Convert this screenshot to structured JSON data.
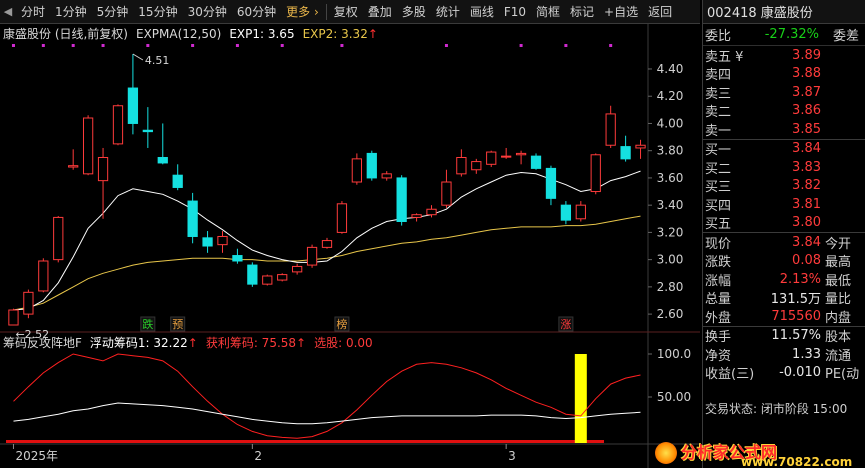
{
  "toolbar": {
    "items": [
      "分时",
      "1分钟",
      "5分钟",
      "15分钟",
      "30分钟",
      "60分钟",
      "更多 ›",
      "复权",
      "叠加",
      "多股",
      "统计",
      "画线",
      "F10",
      "简框",
      "标记",
      "+自选",
      "返回"
    ]
  },
  "chart": {
    "stock_label": "康盛股份 (日线,前复权)",
    "indicator_name": "EXPMA(12,50)",
    "exp1_label": "EXP1: 3.65",
    "exp2_label": "EXP2: 3.32",
    "arrow_up": "↑",
    "high_label": "4.51",
    "low_label": "2.52",
    "y_ticks": [
      "4.40",
      "4.20",
      "4.00",
      "3.80",
      "3.60",
      "3.40",
      "3.20",
      "3.00",
      "2.80",
      "2.60"
    ],
    "sub_ticks": [
      "100.0",
      "50.00"
    ],
    "x_labels": [
      "2025年",
      "2",
      "3"
    ],
    "markers": [
      "跌",
      "预",
      "榜",
      "涨"
    ],
    "colors": {
      "up": "#ff3b3b",
      "down": "#15e0e0",
      "exp1": "#ffffff",
      "exp2": "#e8c64a",
      "profit": "#ff2020",
      "float": "#ffffff",
      "bar": "#ffff00"
    }
  },
  "sub": {
    "indicator_name": "筹码反攻阵地F",
    "float_label": "浮动筹码1: 32.22",
    "float_arrow": "↑",
    "profit_label": "获利筹码: 75.58",
    "profit_arrow": "↑",
    "select_label": "选股: 0.00"
  },
  "chart_data": {
    "type": "candlestick",
    "ylim": [
      2.52,
      4.51
    ],
    "candles": [
      {
        "o": 2.52,
        "h": 2.64,
        "l": 2.52,
        "c": 2.63
      },
      {
        "o": 2.6,
        "h": 2.78,
        "l": 2.57,
        "c": 2.76
      },
      {
        "o": 2.77,
        "h": 3.01,
        "l": 2.76,
        "c": 2.99
      },
      {
        "o": 3.0,
        "h": 3.32,
        "l": 2.98,
        "c": 3.31
      },
      {
        "o": 3.68,
        "h": 3.81,
        "l": 3.66,
        "c": 3.69
      },
      {
        "o": 3.63,
        "h": 4.06,
        "l": 3.62,
        "c": 4.04
      },
      {
        "o": 3.58,
        "h": 3.82,
        "l": 3.3,
        "c": 3.75
      },
      {
        "o": 3.85,
        "h": 4.14,
        "l": 3.84,
        "c": 4.13
      },
      {
        "o": 4.26,
        "h": 4.51,
        "l": 3.92,
        "c": 4.0
      },
      {
        "o": 3.95,
        "h": 4.12,
        "l": 3.82,
        "c": 3.94
      },
      {
        "o": 3.75,
        "h": 4.0,
        "l": 3.7,
        "c": 3.71
      },
      {
        "o": 3.62,
        "h": 3.7,
        "l": 3.51,
        "c": 3.53
      },
      {
        "o": 3.43,
        "h": 3.49,
        "l": 3.12,
        "c": 3.17
      },
      {
        "o": 3.16,
        "h": 3.21,
        "l": 3.05,
        "c": 3.1
      },
      {
        "o": 3.11,
        "h": 3.21,
        "l": 3.05,
        "c": 3.17
      },
      {
        "o": 3.03,
        "h": 3.08,
        "l": 2.97,
        "c": 2.99
      },
      {
        "o": 2.96,
        "h": 2.98,
        "l": 2.8,
        "c": 2.82
      },
      {
        "o": 2.82,
        "h": 2.89,
        "l": 2.81,
        "c": 2.88
      },
      {
        "o": 2.85,
        "h": 2.9,
        "l": 2.84,
        "c": 2.89
      },
      {
        "o": 2.91,
        "h": 2.97,
        "l": 2.89,
        "c": 2.95
      },
      {
        "o": 2.96,
        "h": 3.11,
        "l": 2.94,
        "c": 3.09
      },
      {
        "o": 3.09,
        "h": 3.16,
        "l": 3.08,
        "c": 3.14
      },
      {
        "o": 3.2,
        "h": 3.43,
        "l": 3.19,
        "c": 3.41
      },
      {
        "o": 3.57,
        "h": 3.78,
        "l": 3.55,
        "c": 3.74
      },
      {
        "o": 3.78,
        "h": 3.8,
        "l": 3.58,
        "c": 3.6
      },
      {
        "o": 3.6,
        "h": 3.65,
        "l": 3.58,
        "c": 3.63
      },
      {
        "o": 3.6,
        "h": 3.62,
        "l": 3.25,
        "c": 3.28
      },
      {
        "o": 3.31,
        "h": 3.34,
        "l": 3.28,
        "c": 3.33
      },
      {
        "o": 3.33,
        "h": 3.4,
        "l": 3.31,
        "c": 3.37
      },
      {
        "o": 3.4,
        "h": 3.66,
        "l": 3.38,
        "c": 3.57
      },
      {
        "o": 3.63,
        "h": 3.81,
        "l": 3.61,
        "c": 3.75
      },
      {
        "o": 3.66,
        "h": 3.74,
        "l": 3.63,
        "c": 3.72
      },
      {
        "o": 3.7,
        "h": 3.8,
        "l": 3.68,
        "c": 3.79
      },
      {
        "o": 3.76,
        "h": 3.82,
        "l": 3.74,
        "c": 3.76
      },
      {
        "o": 3.77,
        "h": 3.8,
        "l": 3.7,
        "c": 3.78
      },
      {
        "o": 3.76,
        "h": 3.78,
        "l": 3.66,
        "c": 3.67
      },
      {
        "o": 3.67,
        "h": 3.69,
        "l": 3.4,
        "c": 3.45
      },
      {
        "o": 3.4,
        "h": 3.43,
        "l": 3.26,
        "c": 3.29
      },
      {
        "o": 3.3,
        "h": 3.43,
        "l": 3.28,
        "c": 3.4
      },
      {
        "o": 3.5,
        "h": 3.78,
        "l": 3.48,
        "c": 3.77
      },
      {
        "o": 3.84,
        "h": 4.13,
        "l": 3.82,
        "c": 4.07
      },
      {
        "o": 3.83,
        "h": 3.91,
        "l": 3.72,
        "c": 3.74
      },
      {
        "o": 3.82,
        "h": 3.88,
        "l": 3.74,
        "c": 3.84
      }
    ],
    "exp1": [
      2.63,
      2.64,
      2.7,
      2.83,
      3.02,
      3.23,
      3.34,
      3.47,
      3.52,
      3.5,
      3.48,
      3.43,
      3.37,
      3.29,
      3.22,
      3.14,
      3.07,
      3.03,
      3.0,
      2.98,
      2.98,
      2.99,
      3.06,
      3.16,
      3.23,
      3.28,
      3.3,
      3.31,
      3.33,
      3.37,
      3.46,
      3.52,
      3.57,
      3.62,
      3.64,
      3.63,
      3.59,
      3.55,
      3.5,
      3.52,
      3.58,
      3.61,
      3.65
    ],
    "exp2": [
      2.63,
      2.65,
      2.68,
      2.74,
      2.8,
      2.86,
      2.9,
      2.93,
      2.96,
      2.98,
      2.99,
      3.0,
      3.01,
      3.01,
      3.01,
      3.0,
      3.0,
      2.99,
      2.99,
      2.99,
      3.0,
      3.01,
      3.03,
      3.06,
      3.08,
      3.1,
      3.12,
      3.13,
      3.15,
      3.16,
      3.18,
      3.2,
      3.22,
      3.23,
      3.24,
      3.24,
      3.24,
      3.25,
      3.25,
      3.26,
      3.28,
      3.3,
      3.32
    ],
    "profit_chips": [
      45,
      62,
      78,
      90,
      100,
      96,
      92,
      100,
      98,
      96,
      92,
      80,
      62,
      45,
      30,
      18,
      10,
      5,
      3,
      2,
      4,
      10,
      20,
      35,
      52,
      68,
      80,
      88,
      90,
      88,
      84,
      78,
      70,
      60,
      52,
      44,
      38,
      30,
      28,
      48,
      65,
      72,
      75.58
    ],
    "float_chips": [
      22,
      24,
      27,
      30,
      34,
      36,
      40,
      43,
      42,
      41,
      40,
      38,
      36,
      33,
      30,
      27,
      24,
      22,
      20,
      19,
      19,
      20,
      22,
      24,
      26,
      27,
      28,
      28,
      28,
      28,
      28,
      28,
      29,
      29,
      29,
      28,
      26,
      25,
      26,
      28,
      30,
      31,
      32.22
    ],
    "signal_bar_index": 38,
    "signal_bar_value": 100
  },
  "panel": {
    "title": "002418 康盛股份",
    "ratio_label": "委比",
    "ratio_value": "-27.32%",
    "diff_label": "委差",
    "sells": [
      {
        "label": "卖五 ¥",
        "price": "3.89"
      },
      {
        "label": "卖四",
        "price": "3.88"
      },
      {
        "label": "卖三",
        "price": "3.87"
      },
      {
        "label": "卖二",
        "price": "3.86"
      },
      {
        "label": "卖一",
        "price": "3.85"
      }
    ],
    "buys": [
      {
        "label": "买一",
        "price": "3.84"
      },
      {
        "label": "买二",
        "price": "3.83"
      },
      {
        "label": "买三",
        "price": "3.82"
      },
      {
        "label": "买四",
        "price": "3.81"
      },
      {
        "label": "买五",
        "price": "3.80"
      }
    ],
    "stats": [
      {
        "label": "现价",
        "value": "3.84",
        "label2": "今开",
        "cls": "red"
      },
      {
        "label": "涨跌",
        "value": "0.08",
        "label2": "最高",
        "cls": "red"
      },
      {
        "label": "涨幅",
        "value": "2.13%",
        "label2": "最低",
        "cls": "red"
      },
      {
        "label": "总量",
        "value": "131.5万",
        "label2": "量比",
        "cls": "white"
      },
      {
        "label": "外盘",
        "value": "715560",
        "label2": "内盘",
        "cls": "red"
      }
    ],
    "stats2": [
      {
        "label": "换手",
        "value": "11.57%",
        "label2": "股本",
        "cls": "white"
      },
      {
        "label": "净资",
        "value": "1.33",
        "label2": "流通",
        "cls": "white"
      },
      {
        "label": "收益(三)",
        "value": "-0.010",
        "label2": "PE(动",
        "cls": "white"
      }
    ],
    "trade_stage": "交易状态: 闭市阶段 15:00"
  },
  "logo": {
    "text": "分析家公式网",
    "url": "www.70822.com"
  }
}
